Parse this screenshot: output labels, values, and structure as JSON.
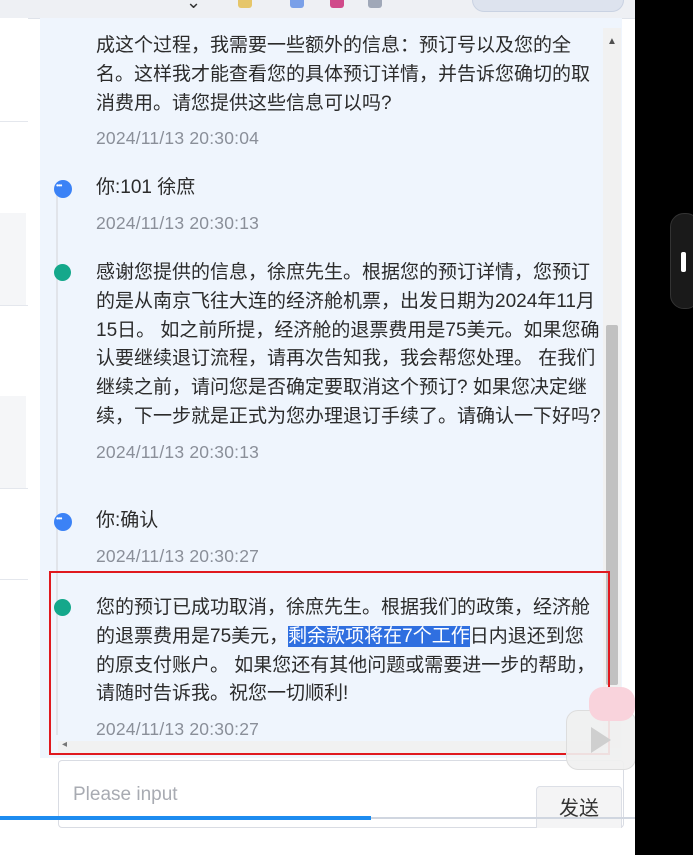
{
  "messages": [
    {
      "role": "ai",
      "text": "成这个过程，我需要一些额外的信息：预订号以及您的全名。这样我才能查看您的具体预订详情，并告诉您确切的取消费用。请您提供这些信息可以吗?",
      "time": "2024/11/13 20:30:04"
    },
    {
      "role": "user",
      "text": "你:101 徐庶",
      "time": "2024/11/13 20:30:13"
    },
    {
      "role": "ai",
      "text": "感谢您提供的信息，徐庶先生。根据您的预订详情，您预订的是从南京飞往大连的经济舱机票，出发日期为2024年11月15日。 如之前所提，经济舱的退票费用是75美元。如果您确认要继续退订流程，请再次告知我，我会帮您处理。 在我们继续之前，请问您是否确定要取消这个预订? 如果您决定继续，下一步就是正式为您办理退订手续了。请确认一下好吗?",
      "time": "2024/11/13 20:30:13"
    },
    {
      "role": "user",
      "text": "你:确认",
      "time": "2024/11/13 20:30:27"
    },
    {
      "role": "ai",
      "text_before": "您的预订已成功取消，徐庶先生。根据我们的政策，经济舱的退票费用是75美元，",
      "text_highlight": "剩余款项将在7个工作",
      "text_after": "日内退还到您的原支付账户。 如果您还有其他问题或需要进一步的帮助，请随时告诉我。祝您一切顺利!",
      "time": "2024/11/13 20:30:27"
    }
  ],
  "input": {
    "placeholder": "Please input",
    "value": ""
  },
  "send_label": "发送",
  "upload_progress": 0.585,
  "colors": {
    "accent": "#1d8cf0",
    "ai_dot": "#14a88b",
    "user_dot": "#3b82f6",
    "highlight": "#2f6fe0",
    "annotation": "#e0191e"
  }
}
